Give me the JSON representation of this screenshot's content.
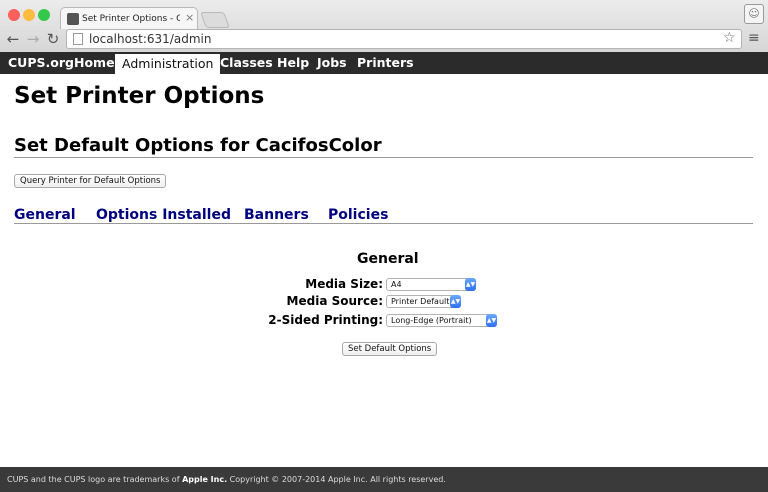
{
  "browser": {
    "tab_title": "Set Printer Options - CUPS",
    "tab_close": "×",
    "url": "localhost:631/admin"
  },
  "nav": {
    "items": [
      "CUPS.org",
      "Home",
      "Administration",
      "Classes",
      "Help",
      "Jobs",
      "Printers"
    ],
    "active": "Administration"
  },
  "page": {
    "title": "Set Printer Options",
    "section_title": "Set Default Options for CacifosColor",
    "query_button": "Query Printer for Default Options",
    "tabs": [
      "General",
      "Options Installed",
      "Banners",
      "Policies"
    ],
    "group_title": "General",
    "options": [
      {
        "label": "Media Size:",
        "value": "A4"
      },
      {
        "label": "Media Source:",
        "value": "Printer Default"
      },
      {
        "label": "2-Sided Printing:",
        "value": "Long-Edge (Portrait)"
      }
    ],
    "submit_button": "Set Default Options"
  },
  "footer": {
    "prefix": "CUPS and the CUPS logo are trademarks of ",
    "company": "Apple Inc.",
    "suffix": " Copyright © 2007-2014 Apple Inc. All rights reserved."
  },
  "colors": {
    "nav_bg": "#2b2b2b",
    "tab_link": "#000080",
    "footer_bg": "#3a3a3a"
  }
}
